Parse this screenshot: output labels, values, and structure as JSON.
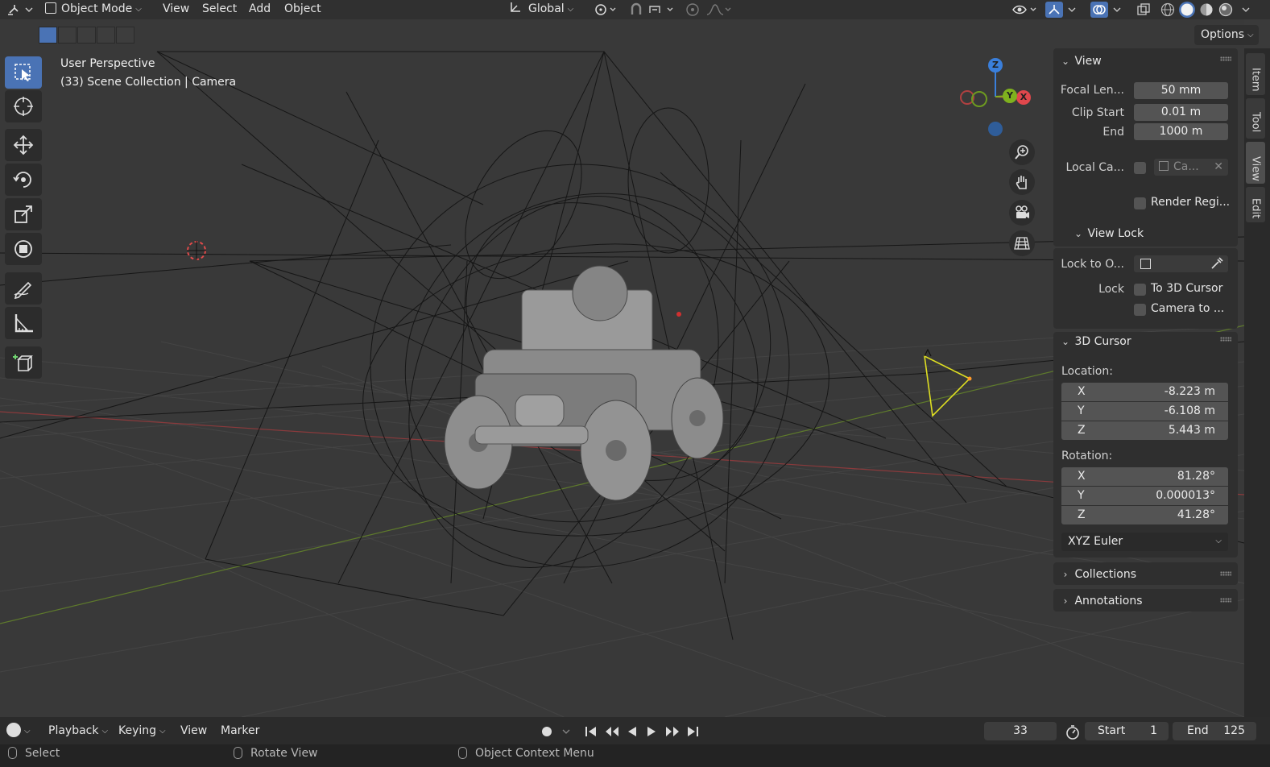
{
  "header": {
    "mode_label": "Object Mode",
    "menus": [
      "View",
      "Select",
      "Add",
      "Object"
    ],
    "transform_orientation": "Global",
    "options_label": "Options"
  },
  "viewport": {
    "perspective_label": "User Perspective",
    "collection_label": "(33) Scene Collection | Camera",
    "gizmo": {
      "z": "Z",
      "y": "Y",
      "x": "X"
    }
  },
  "toolbar": {
    "tools": [
      "select-box",
      "cursor",
      "move",
      "rotate",
      "scale",
      "transform",
      "annotate",
      "measure",
      "add-cube"
    ],
    "active": "select-box"
  },
  "npanel": {
    "view": {
      "title": "View",
      "focal_length_label": "Focal Len...",
      "focal_length_value": "50 mm",
      "clip_start_label": "Clip Start",
      "clip_start_value": "0.01 m",
      "clip_end_label": "End",
      "clip_end_value": "1000 m",
      "local_camera_label": "Local Ca...",
      "local_camera_value": "Ca...",
      "render_region_label": "Render Regi..."
    },
    "view_lock": {
      "title": "View Lock",
      "lock_to_object_label": "Lock to O...",
      "lock_label": "Lock",
      "to_3d_cursor_label": "To 3D Cursor",
      "camera_to_view_label": "Camera to ..."
    },
    "cursor": {
      "title": "3D Cursor",
      "location_label": "Location:",
      "location": [
        {
          "axis": "X",
          "value": "-8.223 m"
        },
        {
          "axis": "Y",
          "value": "-6.108 m"
        },
        {
          "axis": "Z",
          "value": "5.443 m"
        }
      ],
      "rotation_label": "Rotation:",
      "rotation": [
        {
          "axis": "X",
          "value": "81.28°"
        },
        {
          "axis": "Y",
          "value": "0.000013°"
        },
        {
          "axis": "Z",
          "value": "41.28°"
        }
      ],
      "rotation_mode": "XYZ Euler"
    },
    "collections_title": "Collections",
    "annotations_title": "Annotations"
  },
  "sidetabs": [
    "Item",
    "Tool",
    "View",
    "Edit"
  ],
  "timeline": {
    "menus": [
      "Playback",
      "Keying",
      "View",
      "Marker"
    ],
    "current_frame": "33",
    "start_label": "Start",
    "start_value": "1",
    "end_label": "End",
    "end_value": "125"
  },
  "statusbar": {
    "left": "Select",
    "middle": "Rotate View",
    "right": "Object Context Menu"
  },
  "colors": {
    "accent": "#4a73b5",
    "axis_x": "#e0474c",
    "axis_y": "#7fb11e",
    "axis_z": "#3a7fdb"
  }
}
